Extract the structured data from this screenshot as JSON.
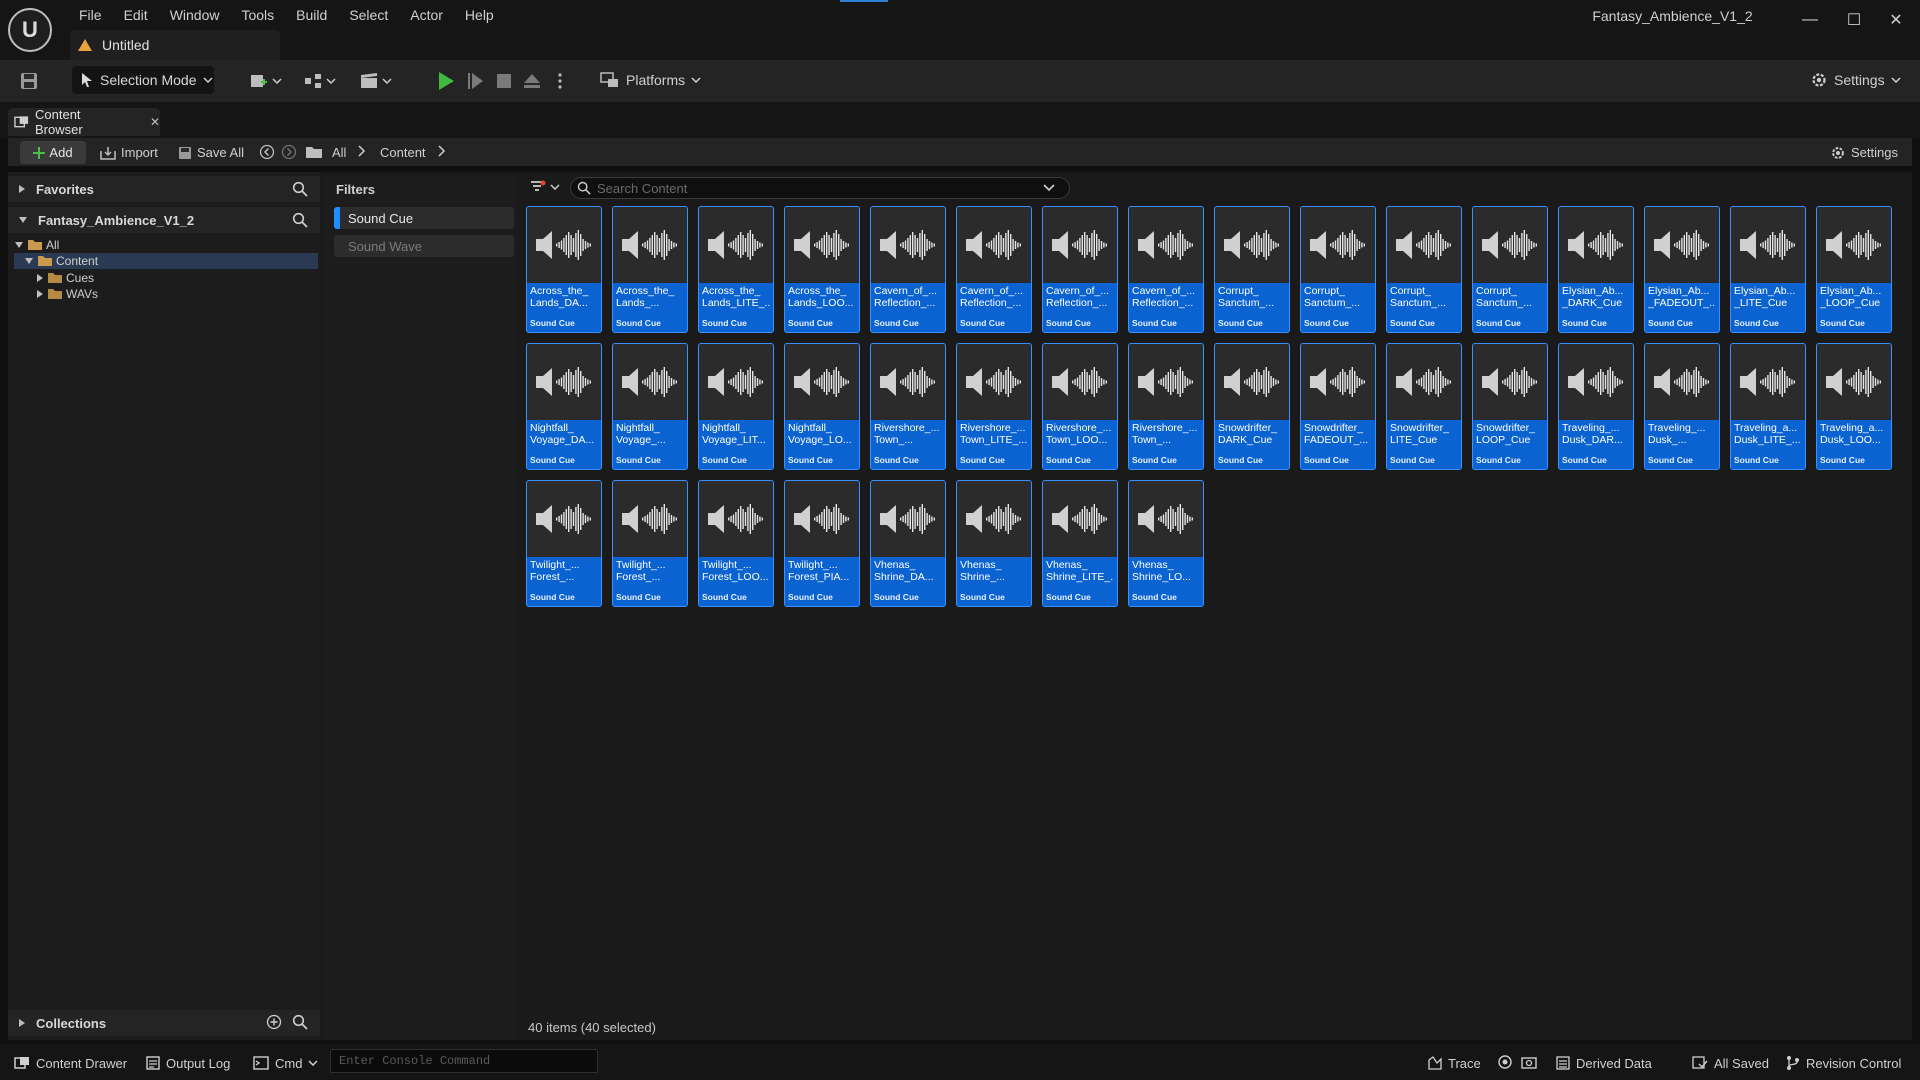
{
  "app": {
    "logo_text": "U",
    "menu": [
      "File",
      "Edit",
      "Window",
      "Tools",
      "Build",
      "Select",
      "Actor",
      "Help"
    ],
    "document_tab": "Untitled",
    "project_name": "Fantasy_Ambience_V1_2",
    "window_controls": [
      "minimize-icon",
      "maximize-icon",
      "close-icon"
    ],
    "accent_color": "#0b63d1"
  },
  "toolbar": {
    "selection_mode": "Selection Mode",
    "platforms": "Platforms",
    "settings": "Settings"
  },
  "content_browser": {
    "tab_label": "Content Browser",
    "add_label": "Add",
    "import_label": "Import",
    "save_all_label": "Save All",
    "breadcrumb": [
      "All",
      "Content"
    ],
    "settings_label": "Settings",
    "favorites_label": "Favorites",
    "project_label": "Fantasy_Ambience_V1_2",
    "tree": {
      "all": "All",
      "content": "Content",
      "cues": "Cues",
      "wavs": "WAVs"
    },
    "collections_label": "Collections",
    "filters_title": "Filters",
    "filters": [
      {
        "label": "Sound Cue",
        "active": true
      },
      {
        "label": "Sound Wave",
        "active": false
      }
    ],
    "search_placeholder": "Search Content",
    "item_count": "40 items (40 selected)",
    "assets": [
      {
        "l1": "Across_the_",
        "l2": "Lands_DA...",
        "type": "Sound Cue"
      },
      {
        "l1": "Across_the_",
        "l2": "Lands_...",
        "type": "Sound Cue"
      },
      {
        "l1": "Across_the_",
        "l2": "Lands_LITE_...",
        "type": "Sound Cue"
      },
      {
        "l1": "Across_the_",
        "l2": "Lands_LOO...",
        "type": "Sound Cue"
      },
      {
        "l1": "Cavern_of_...",
        "l2": "Reflection_...",
        "type": "Sound Cue"
      },
      {
        "l1": "Cavern_of_...",
        "l2": "Reflection_...",
        "type": "Sound Cue"
      },
      {
        "l1": "Cavern_of_...",
        "l2": "Reflection_...",
        "type": "Sound Cue"
      },
      {
        "l1": "Cavern_of_...",
        "l2": "Reflection_...",
        "type": "Sound Cue"
      },
      {
        "l1": "Corrupt_",
        "l2": "Sanctum_...",
        "type": "Sound Cue"
      },
      {
        "l1": "Corrupt_",
        "l2": "Sanctum_...",
        "type": "Sound Cue"
      },
      {
        "l1": "Corrupt_",
        "l2": "Sanctum_...",
        "type": "Sound Cue"
      },
      {
        "l1": "Corrupt_",
        "l2": "Sanctum_...",
        "type": "Sound Cue"
      },
      {
        "l1": "Elysian_Ab...",
        "l2": "_DARK_Cue",
        "type": "Sound Cue"
      },
      {
        "l1": "Elysian_Ab...",
        "l2": "_FADEOUT_...",
        "type": "Sound Cue"
      },
      {
        "l1": "Elysian_Ab...",
        "l2": "_LITE_Cue",
        "type": "Sound Cue"
      },
      {
        "l1": "Elysian_Ab...",
        "l2": "_LOOP_Cue",
        "type": "Sound Cue"
      },
      {
        "l1": "Nightfall_",
        "l2": "Voyage_DA...",
        "type": "Sound Cue"
      },
      {
        "l1": "Nightfall_",
        "l2": "Voyage_...",
        "type": "Sound Cue"
      },
      {
        "l1": "Nightfall_",
        "l2": "Voyage_LIT...",
        "type": "Sound Cue"
      },
      {
        "l1": "Nightfall_",
        "l2": "Voyage_LO...",
        "type": "Sound Cue"
      },
      {
        "l1": "Rivershore_...",
        "l2": "Town_...",
        "type": "Sound Cue"
      },
      {
        "l1": "Rivershore_...",
        "l2": "Town_LITE_...",
        "type": "Sound Cue"
      },
      {
        "l1": "Rivershore_...",
        "l2": "Town_LOO...",
        "type": "Sound Cue"
      },
      {
        "l1": "Rivershore_...",
        "l2": "Town_...",
        "type": "Sound Cue"
      },
      {
        "l1": "Snowdrifter_",
        "l2": "DARK_Cue",
        "type": "Sound Cue"
      },
      {
        "l1": "Snowdrifter_",
        "l2": "FADEOUT_...",
        "type": "Sound Cue"
      },
      {
        "l1": "Snowdrifter_",
        "l2": "LITE_Cue",
        "type": "Sound Cue"
      },
      {
        "l1": "Snowdrifter_",
        "l2": "LOOP_Cue",
        "type": "Sound Cue"
      },
      {
        "l1": "Traveling_...",
        "l2": "Dusk_DAR...",
        "type": "Sound Cue"
      },
      {
        "l1": "Traveling_...",
        "l2": "Dusk_...",
        "type": "Sound Cue"
      },
      {
        "l1": "Traveling_a...",
        "l2": "Dusk_LITE_...",
        "type": "Sound Cue"
      },
      {
        "l1": "Traveling_a...",
        "l2": "Dusk_LOO...",
        "type": "Sound Cue"
      },
      {
        "l1": "Twilight_...",
        "l2": "Forest_...",
        "type": "Sound Cue"
      },
      {
        "l1": "Twilight_...",
        "l2": "Forest_...",
        "type": "Sound Cue"
      },
      {
        "l1": "Twilight_...",
        "l2": "Forest_LOO...",
        "type": "Sound Cue"
      },
      {
        "l1": "Twilight_...",
        "l2": "Forest_PIA...",
        "type": "Sound Cue"
      },
      {
        "l1": "Vhenas_",
        "l2": "Shrine_DA...",
        "type": "Sound Cue"
      },
      {
        "l1": "Vhenas_",
        "l2": "Shrine_...",
        "type": "Sound Cue"
      },
      {
        "l1": "Vhenas_",
        "l2": "Shrine_LITE_...",
        "type": "Sound Cue"
      },
      {
        "l1": "Vhenas_",
        "l2": "Shrine_LO...",
        "type": "Sound Cue"
      }
    ]
  },
  "statusbar": {
    "content_drawer": "Content Drawer",
    "output_log": "Output Log",
    "cmd": "Cmd",
    "console_placeholder": "Enter Console Command",
    "trace": "Trace",
    "derived_data": "Derived Data",
    "all_saved": "All Saved",
    "revision_control": "Revision Control"
  }
}
